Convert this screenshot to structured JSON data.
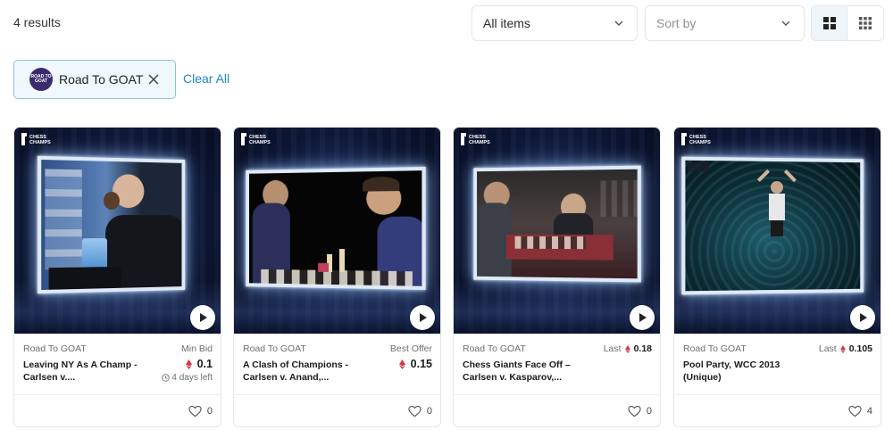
{
  "toolbar": {
    "results_count": "4 results",
    "items_filter": {
      "selected": "All items"
    },
    "sort": {
      "placeholder": "Sort by"
    },
    "view_modes": [
      "grid-large",
      "grid-small"
    ],
    "active_view": "grid-large"
  },
  "filters": {
    "chip_label": "Road To GOAT",
    "chip_logo_text": "ROAD TO GOAT",
    "clear_all": "Clear All"
  },
  "brand": {
    "logo_text_1": "CHESS",
    "logo_text_2": "CHAMPS",
    "accent": "#1f87cc",
    "eth_color": "#d23b4a"
  },
  "cards": [
    {
      "collection": "Road To GOAT",
      "title": "Leaving NY As A Champ - Carlsen v....",
      "price_label": "Min Bid",
      "price": "0.1",
      "time_left": "4 days left",
      "likes": "0"
    },
    {
      "collection": "Road To GOAT",
      "title": "A Clash of Champions - Carlsen v. Anand,...",
      "price_label": "Best Offer",
      "price": "0.15",
      "likes": "0"
    },
    {
      "collection": "Road To GOAT",
      "title": "Chess Giants Face Off – Carlsen v. Kasparov,...",
      "price_label": "Last",
      "price": "0.18",
      "likes": "0"
    },
    {
      "collection": "Road To GOAT",
      "title": "Pool Party, WCC 2013 (Unique)",
      "price_label": "Last",
      "price": "0.105",
      "likes": "4"
    }
  ]
}
